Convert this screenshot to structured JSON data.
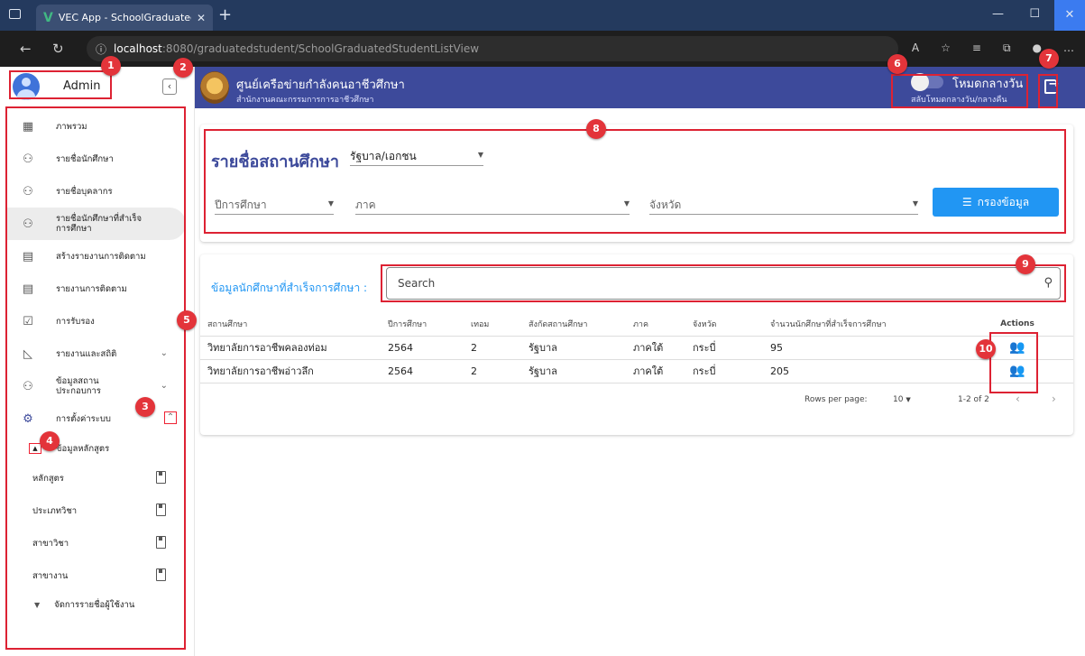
{
  "browser": {
    "tab_title": "VEC App - SchoolGraduatedStuc",
    "tab_logo": "V",
    "url_host": "localhost",
    "url_path": ":8080/graduatedstudent/SchoolGraduatedStudentListView"
  },
  "sidebar": {
    "user_name": "Admin",
    "items": [
      {
        "label": "ภาพรวม",
        "icon": "dashboard-icon"
      },
      {
        "label": "รายชื่อนักศึกษา",
        "icon": "people-icon"
      },
      {
        "label": "รายชื่อบุคลากร",
        "icon": "people-icon"
      },
      {
        "label": "รายชื่อนักศึกษาที่สำเร็จการศึกษา",
        "icon": "people-icon"
      },
      {
        "label": "สร้างรายงานการติดตาม",
        "icon": "document-icon"
      },
      {
        "label": "รายงานการติดตาม",
        "icon": "document-icon"
      },
      {
        "label": "การรับรอง",
        "icon": "clipboard-check-icon"
      },
      {
        "label": "รายงานและสถิติ",
        "icon": "chart-icon"
      },
      {
        "label": "ข้อมูลสถานประกอบการ",
        "icon": "people-icon"
      },
      {
        "label": "การตั้งค่าระบบ",
        "icon": "gear-icon"
      }
    ],
    "sub_head": "ข้อมูลหลักสูตร",
    "sub_items": [
      "หลักสูตร",
      "ประเภทวิชา",
      "สาขาวิชา",
      "สาขางาน"
    ],
    "user_mgmt": "จัดการรายชื่อผู้ใช้งาน"
  },
  "header": {
    "org_name": "ศูนย์เครือข่ายกำลังคนอาชีวศึกษา",
    "org_sub": "สำนักงานคณะกรรมการการอาชีวศึกษา",
    "mode_label": "โหมดกลางวัน",
    "mode_sub": "สลับโหมดกลางวัน/กลางคืน"
  },
  "filter": {
    "title": "รายชื่อสถานศึกษา",
    "type_value": "รัฐบาล/เอกชน",
    "year_placeholder": "ปีการศึกษา",
    "region_placeholder": "ภาค",
    "province_placeholder": "จังหวัด",
    "button_label": "กรองข้อมูล"
  },
  "data": {
    "title": "ข้อมูลนักศึกษาที่สำเร็จการศึกษา :",
    "search_placeholder": "Search",
    "columns": [
      "สถานศึกษา",
      "ปีการศึกษา",
      "เทอม",
      "สังกัดสถานศึกษา",
      "ภาค",
      "จังหวัด",
      "จำนวนนักศึกษาที่สำเร็จการศึกษา",
      "Actions"
    ],
    "rows": [
      [
        "วิทยาลัยการอาชีพคลองท่อม",
        "2564",
        "2",
        "รัฐบาล",
        "ภาคใต้",
        "กระบี่",
        "95"
      ],
      [
        "วิทยาลัยการอาชีพอ่าวลึก",
        "2564",
        "2",
        "รัฐบาล",
        "ภาคใต้",
        "กระบี่",
        "205"
      ]
    ],
    "rows_per_page_label": "Rows per page:",
    "rows_per_page_value": "10",
    "range": "1-2 of 2"
  },
  "badges": [
    "1",
    "2",
    "3",
    "4",
    "5",
    "6",
    "7",
    "8",
    "9",
    "10"
  ],
  "colors": {
    "primary": "#3d4a9b",
    "accent": "#2196f3",
    "annotation": "#e3343a"
  }
}
